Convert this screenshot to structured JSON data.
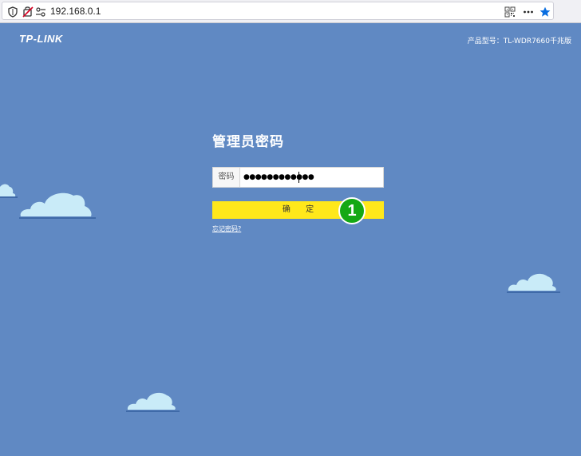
{
  "browser": {
    "url": "192.168.0.1",
    "icons": [
      "shield-icon",
      "tracking-blocked-icon",
      "permissions-icon",
      "qr-code-icon",
      "more-icon",
      "bookmark-star-icon"
    ]
  },
  "header": {
    "brand": "TP-LINK",
    "model": "产品型号：TL-WDR7660千兆版"
  },
  "login": {
    "title": "管理员密码",
    "password_label": "密码",
    "password_value": "●●●●●●●●●●●●",
    "confirm_label": "确 定",
    "forgot_link": "忘记密码?"
  },
  "annotation": {
    "step": "1"
  },
  "colors": {
    "background": "#6089c3",
    "button": "#ffe81b",
    "badge": "#14a814",
    "cloud": "#c9ebf8"
  }
}
